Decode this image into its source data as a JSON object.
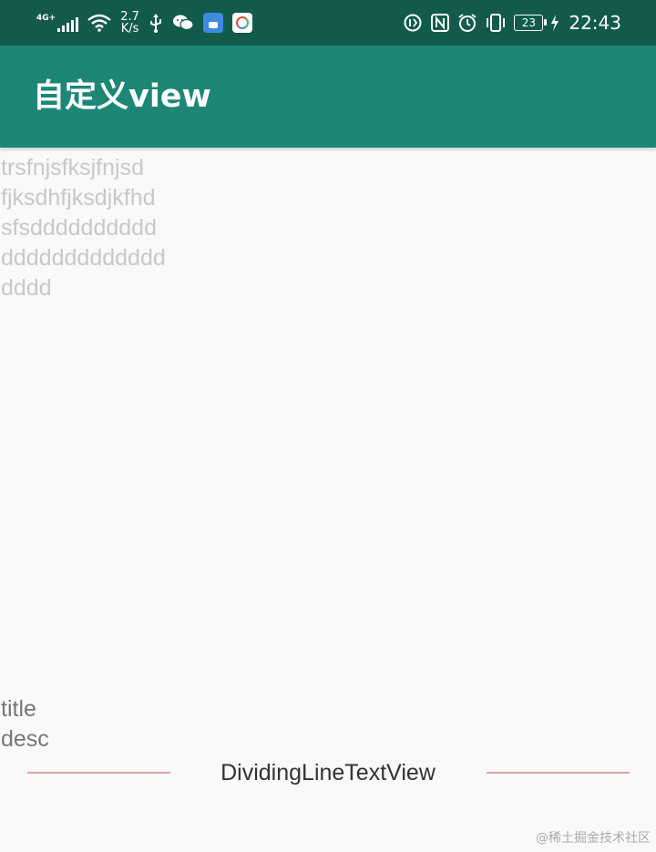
{
  "colors": {
    "status_bar": "#125b4c",
    "toolbar": "#1e8675",
    "background": "#f9f9f9",
    "body_text_light": "#c8c8c8",
    "label_text": "#777777",
    "divider_text": "#333333",
    "divider_line": "#d9a3ad"
  },
  "status_bar": {
    "network_type": "4G+",
    "speed_value": "2.7",
    "speed_unit": "K/s",
    "left_icons": [
      "signal-icon",
      "wifi-icon",
      "usb-icon",
      "wechat-icon",
      "wallet-app-icon",
      "browser-app-icon"
    ],
    "right_icons": [
      "data-saver-icon",
      "nfc-icon",
      "alarm-icon",
      "vibrate-icon",
      "charging-icon"
    ],
    "battery_level": "23",
    "time": "22:43"
  },
  "toolbar": {
    "title": "自定义view"
  },
  "content": {
    "lines": [
      "trsfnjsfksjfnjsd",
      "fjksdhfjksdjkfhd",
      "sfsdddddddddd",
      "ddddddddddddd",
      "dddd"
    ],
    "title": "title",
    "desc": "desc",
    "divider_label": "DividingLineTextView"
  },
  "watermark": "@稀土掘金技术社区"
}
